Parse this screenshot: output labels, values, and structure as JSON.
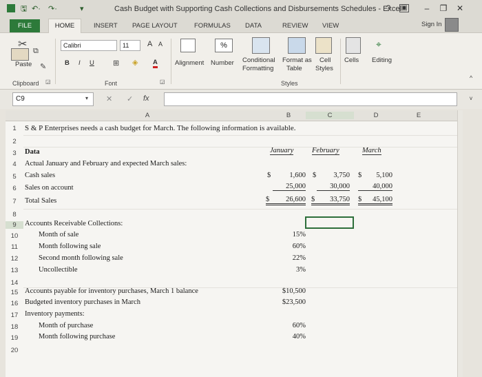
{
  "window": {
    "title": "Cash Budget with Supporting Cash Collections and Disbursements Schedules - Excel",
    "help": "?",
    "minimize": "–",
    "restore": "❐",
    "close": "✕"
  },
  "tabs": [
    "FILE",
    "HOME",
    "INSERT",
    "PAGE LAYOUT",
    "FORMULAS",
    "DATA",
    "REVIEW",
    "VIEW"
  ],
  "sign_in": "Sign In",
  "ribbon": {
    "paste": "Paste",
    "font_name": "Calibri",
    "font_size": "11",
    "grow_font": "A",
    "shrink_font": "A",
    "bold": "B",
    "italic": "I",
    "underline": "U",
    "font_color": "A",
    "alignment": "Alignment",
    "number": "Number",
    "percent": "%",
    "conditional_formatting": "Conditional\nFormatting",
    "conditional_line1": "Conditional",
    "conditional_line2": "Formatting",
    "format_as_table_line1": "Format as",
    "format_as_table_line2": "Table",
    "cell_styles_line1": "Cell",
    "cell_styles_line2": "Styles",
    "cells": "Cells",
    "editing": "Editing",
    "groups": {
      "clipboard": "Clipboard",
      "font": "Font",
      "styles": "Styles"
    }
  },
  "formula_bar": {
    "name_box": "C9",
    "cancel": "✕",
    "enter": "✓",
    "fx": "fx",
    "value": ""
  },
  "sheet": {
    "columns": [
      "A",
      "B",
      "C",
      "D",
      "E"
    ],
    "rows": [
      "1",
      "2",
      "3",
      "4",
      "5",
      "6",
      "7",
      "8",
      "9",
      "10",
      "11",
      "12",
      "13",
      "14",
      "15",
      "16",
      "17",
      "18",
      "19",
      "20"
    ],
    "r1": "S & P Enterprises needs a cash budget for March. The following information is available.",
    "r3": {
      "label": "Data",
      "january": "January",
      "february": "February",
      "march": "March"
    },
    "r4": "Actual January and February and expected March sales:",
    "r5": {
      "label": "Cash sales",
      "jan_sym": "$",
      "jan": "1,600",
      "feb_sym": "$",
      "feb": "3,750",
      "mar_sym": "$",
      "mar": "5,100"
    },
    "r6": {
      "label": "Sales on account",
      "jan": "25,000",
      "feb": "30,000",
      "mar": "40,000"
    },
    "r7": {
      "label": "Total Sales",
      "jan_sym": "$",
      "jan": "26,600",
      "feb_sym": "$",
      "feb": "33,750",
      "mar_sym": "$",
      "mar": "45,100"
    },
    "r9": "Accounts Receivable Collections:",
    "r10": {
      "label": "Month of sale",
      "value": "15%"
    },
    "r11": {
      "label": "Month following sale",
      "value": "60%"
    },
    "r12": {
      "label": "Second month following sale",
      "value": "22%"
    },
    "r13": {
      "label": "Uncollectible",
      "value": "3%"
    },
    "r15": {
      "label": "Accounts payable for inventory purchases, March 1 balance",
      "value": "$10,500"
    },
    "r16": {
      "label": "Budgeted inventory purchases in March",
      "value": "$23,500"
    },
    "r17": "Inventory payments:",
    "r18": {
      "label": "Month of purchase",
      "value": "60%"
    },
    "r19": {
      "label": "Month following purchase",
      "value": "40%"
    }
  },
  "colors": {
    "file_tab": "#2d7a3a",
    "selection_border": "#2c6e3a",
    "ribbon_bg": "#f1efea"
  }
}
